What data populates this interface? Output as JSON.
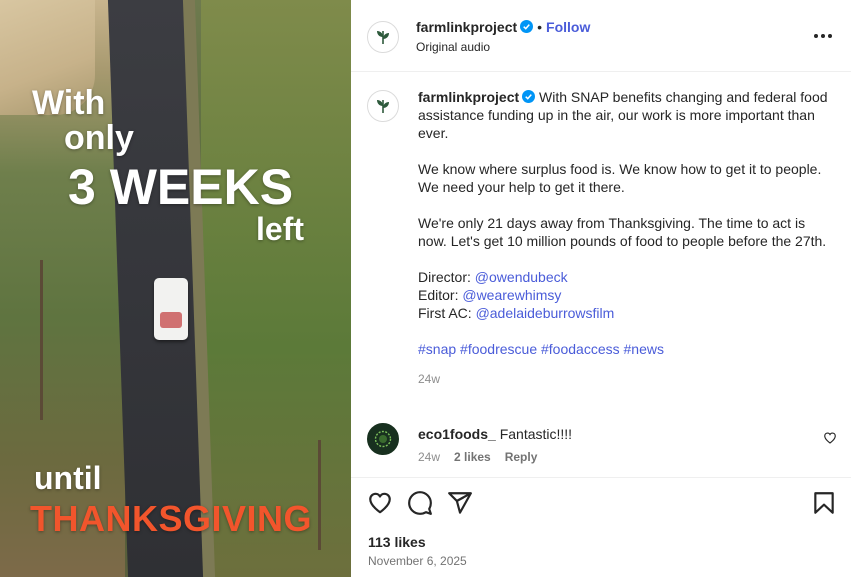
{
  "media": {
    "overlay": {
      "line1": "With",
      "line2": "only",
      "line3": "3 WEEKS",
      "line4": "left",
      "line5": "until",
      "line6": "THANKSGIVING"
    },
    "highlight_color": "#f2552c"
  },
  "post": {
    "username": "farmlinkproject",
    "separator": "•",
    "follow_label": "Follow",
    "audio_label": "Original audio",
    "more_icon": "more-horizontal-icon",
    "accent_color": "#4a5cd9"
  },
  "caption": {
    "username": "farmlinkproject",
    "para1": "With SNAP benefits changing and federal food assistance funding up in the air, our work is more important than ever.",
    "para2": "We know where surplus food is. We know how to get it to people. We need your help to get it there.",
    "para3": "We're only 21 days away from Thanksgiving. The time to act is now. Let's get 10 million pounds of food to people before the 27th.",
    "credits": [
      {
        "role": "Director:",
        "handle": "@owendubeck"
      },
      {
        "role": "Editor:",
        "handle": "@wearewhimsy"
      },
      {
        "role": "First AC:",
        "handle": "@adelaideburrowsfilm"
      }
    ],
    "hashtags": [
      "#snap",
      "#foodrescue",
      "#foodaccess",
      "#news"
    ],
    "time": "24w"
  },
  "comment": {
    "username": "eco1foods_",
    "text": "Fantastic!!!!",
    "time": "24w",
    "likes": "2 likes",
    "reply_label": "Reply"
  },
  "actions": {
    "icons": [
      "heart-icon",
      "comment-icon",
      "share-icon",
      "bookmark-icon"
    ],
    "likes": "113 likes",
    "date": "November 6, 2025"
  }
}
